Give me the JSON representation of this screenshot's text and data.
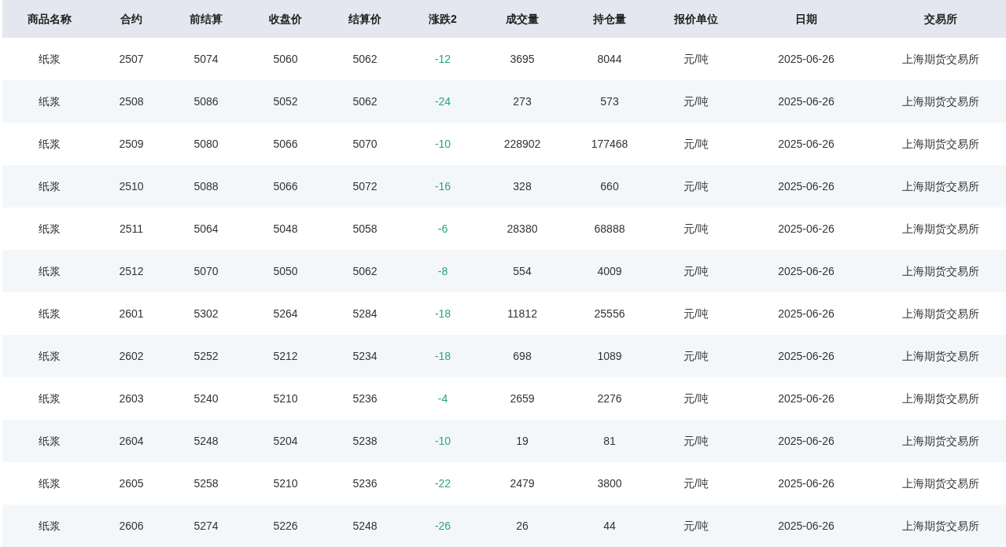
{
  "table": {
    "columns": [
      "商品名称",
      "合约",
      "前结算",
      "收盘价",
      "结算价",
      "涨跌2",
      "成交量",
      "持仓量",
      "报价单位",
      "日期",
      "交易所"
    ],
    "rows": [
      [
        "纸浆",
        "2507",
        "5074",
        "5060",
        "5062",
        "-12",
        "3695",
        "8044",
        "元/吨",
        "2025-06-26",
        "上海期货交易所"
      ],
      [
        "纸浆",
        "2508",
        "5086",
        "5052",
        "5062",
        "-24",
        "273",
        "573",
        "元/吨",
        "2025-06-26",
        "上海期货交易所"
      ],
      [
        "纸浆",
        "2509",
        "5080",
        "5066",
        "5070",
        "-10",
        "228902",
        "177468",
        "元/吨",
        "2025-06-26",
        "上海期货交易所"
      ],
      [
        "纸浆",
        "2510",
        "5088",
        "5066",
        "5072",
        "-16",
        "328",
        "660",
        "元/吨",
        "2025-06-26",
        "上海期货交易所"
      ],
      [
        "纸浆",
        "2511",
        "5064",
        "5048",
        "5058",
        "-6",
        "28380",
        "68888",
        "元/吨",
        "2025-06-26",
        "上海期货交易所"
      ],
      [
        "纸浆",
        "2512",
        "5070",
        "5050",
        "5062",
        "-8",
        "554",
        "4009",
        "元/吨",
        "2025-06-26",
        "上海期货交易所"
      ],
      [
        "纸浆",
        "2601",
        "5302",
        "5264",
        "5284",
        "-18",
        "11812",
        "25556",
        "元/吨",
        "2025-06-26",
        "上海期货交易所"
      ],
      [
        "纸浆",
        "2602",
        "5252",
        "5212",
        "5234",
        "-18",
        "698",
        "1089",
        "元/吨",
        "2025-06-26",
        "上海期货交易所"
      ],
      [
        "纸浆",
        "2603",
        "5240",
        "5210",
        "5236",
        "-4",
        "2659",
        "2276",
        "元/吨",
        "2025-06-26",
        "上海期货交易所"
      ],
      [
        "纸浆",
        "2604",
        "5248",
        "5204",
        "5238",
        "-10",
        "19",
        "81",
        "元/吨",
        "2025-06-26",
        "上海期货交易所"
      ],
      [
        "纸浆",
        "2605",
        "5258",
        "5210",
        "5236",
        "-22",
        "2479",
        "3800",
        "元/吨",
        "2025-06-26",
        "上海期货交易所"
      ],
      [
        "纸浆",
        "2606",
        "5274",
        "5226",
        "5248",
        "-26",
        "26",
        "44",
        "元/吨",
        "2025-06-26",
        "上海期货交易所"
      ]
    ]
  }
}
